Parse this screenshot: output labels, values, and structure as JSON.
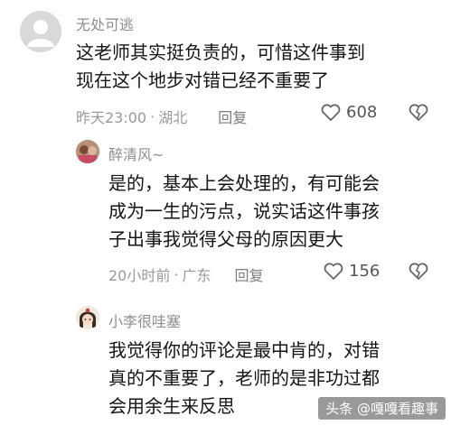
{
  "comments": [
    {
      "user": "无处可逃",
      "lines": [
        "这老师其实挺负责的，可惜这件事到",
        "现在这个地步对错已经不重要了"
      ],
      "time": "昨天23:00",
      "location": "湖北",
      "reply": "回复",
      "likes": "608",
      "avatar_icon": "default-avatar-icon"
    },
    {
      "user": "醉清风~",
      "lines": [
        "是的，基本上会处理的，有可能会",
        "成为一生的污点，说实话这件事孩",
        "子出事我觉得父母的原因更大"
      ],
      "time": "20小时前",
      "location": "广东",
      "reply": "回复",
      "likes": "156",
      "avatar_icon": "user-photo-icon"
    },
    {
      "user": "小李很哇塞",
      "lines": [
        "我觉得你的评论是最中肯的，对错",
        "真的不重要了，老师的是非功过都",
        "会用余生来反思"
      ],
      "avatar_icon": "cartoon-girl-icon"
    }
  ],
  "separator": "·",
  "watermark": "头条 @嘎嘎看趣事",
  "colors": {
    "text": "#141414",
    "meta": "#9a9a9a",
    "name": "#8e8e8e"
  }
}
